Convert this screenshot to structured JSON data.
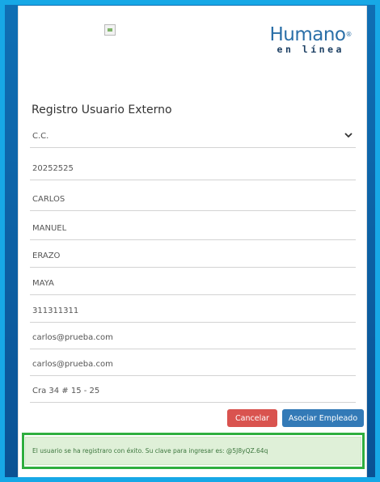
{
  "logo": {
    "main": "Humano",
    "reg": "®",
    "sub": "en línea"
  },
  "form": {
    "title": "Registro Usuario Externo",
    "fields": [
      {
        "name": "doc-type-select",
        "value": "C.C."
      },
      {
        "name": "document-number-field",
        "value": "20252525"
      },
      {
        "name": "first-name-field",
        "value": "CARLOS"
      },
      {
        "name": "second-name-field",
        "value": "MANUEL"
      },
      {
        "name": "first-surname-field",
        "value": "ERAZO"
      },
      {
        "name": "second-surname-field",
        "value": "MAYA"
      },
      {
        "name": "phone-field",
        "value": "311311311"
      },
      {
        "name": "email-field",
        "value": "carlos@prueba.com"
      },
      {
        "name": "confirm-email-field",
        "value": "carlos@prueba.com"
      },
      {
        "name": "address-field",
        "value": "Cra 34 # 15 - 25"
      }
    ]
  },
  "buttons": {
    "cancel": "Cancelar",
    "associate": "Asociar Empleado"
  },
  "alert": {
    "message": "El usuario se ha registraro con éxito. Su clave para ingresar es: @5J8yQZ.64q"
  },
  "colors": {
    "cancel": "#d9534f",
    "primary": "#337ab7",
    "success_bg": "#dff0d8",
    "highlight": "#2fae3f",
    "frame": "#17a8e6"
  }
}
